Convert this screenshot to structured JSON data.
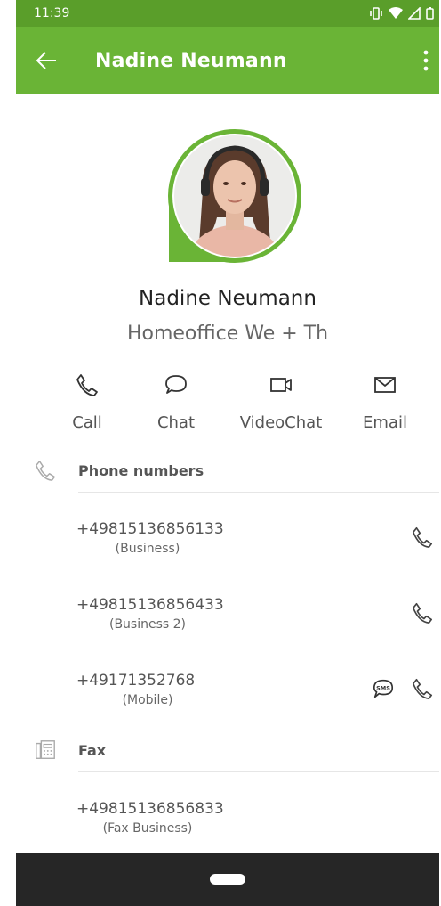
{
  "status_bar": {
    "time": "11:39",
    "icons": [
      "vibrate-icon",
      "wifi-icon",
      "signal-icon",
      "battery-icon"
    ],
    "color": "#5a9e2a"
  },
  "app_bar": {
    "title": "Nadine Neumann",
    "color": "#6ab436"
  },
  "contact": {
    "name": "Nadine Neumann",
    "status": "Homeoffice We + Th"
  },
  "actions": [
    {
      "label": "Call",
      "icon": "phone-icon"
    },
    {
      "label": "Chat",
      "icon": "chat-bubble-icon"
    },
    {
      "label": "VideoChat",
      "icon": "video-camera-icon"
    },
    {
      "label": "Email",
      "icon": "envelope-icon"
    }
  ],
  "phone_section": {
    "title": "Phone numbers",
    "icon": "phone-icon",
    "entries": [
      {
        "number": "+49815136856133",
        "type": "(Business)"
      },
      {
        "number": "+49815136856433",
        "type": "(Business 2)"
      },
      {
        "number": "+49171352768",
        "type": "(Mobile)"
      }
    ]
  },
  "fax_section": {
    "title": "Fax",
    "icon": "fax-icon",
    "entries": [
      {
        "number": "+49815136856833",
        "type": "(Fax Business)"
      }
    ]
  }
}
